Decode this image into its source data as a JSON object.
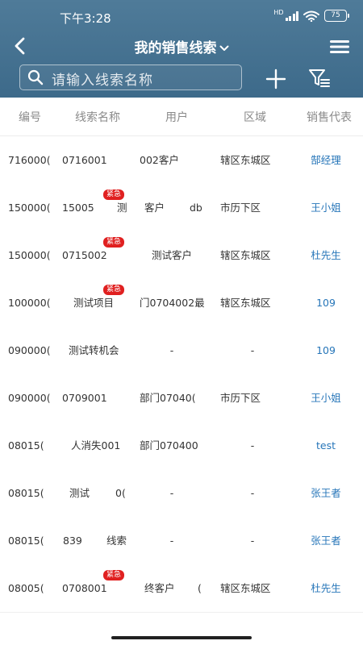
{
  "status_bar": {
    "time": "下午3:28",
    "signal_label": "HD",
    "battery": "75"
  },
  "nav": {
    "title": "我的销售线索"
  },
  "search": {
    "placeholder": "请输入线索名称"
  },
  "table": {
    "headers": [
      "编号",
      "线索名称",
      "用户",
      "区域",
      "销售代表"
    ],
    "rows": [
      {
        "code": "716000(",
        "name": "0716001",
        "urgent": false,
        "customer": "002客户",
        "region": "辖区东城区",
        "rep": "郜经理"
      },
      {
        "code": "150000(",
        "name": "15005",
        "name_extra": "测",
        "urgent": true,
        "customer": "客户",
        "customer_extra": "db",
        "region": "市历下区",
        "rep": "王小姐"
      },
      {
        "code": "150000(",
        "name": "0715002",
        "urgent": true,
        "customer": "测试客户",
        "region": "辖区东城区",
        "rep": "杜先生"
      },
      {
        "code": "100000(",
        "name": "测试项目",
        "urgent": true,
        "customer": "门0704002最",
        "region": "辖区东城区",
        "rep": "109"
      },
      {
        "code": "090000(",
        "name": "测试转机会",
        "urgent": false,
        "customer": "-",
        "region": "-",
        "rep": "109"
      },
      {
        "code": "090000(",
        "name": "0709001",
        "urgent": false,
        "customer": "部门07040(",
        "region": "市历下区",
        "rep": "王小姐"
      },
      {
        "code": "08015(",
        "name": "人消失001",
        "urgent": false,
        "customer": "部门070400",
        "region": "-",
        "rep": "test"
      },
      {
        "code": "08015(",
        "name": "测试",
        "name_extra": "0(",
        "urgent": false,
        "customer": "-",
        "region": "-",
        "rep": "张王者"
      },
      {
        "code": "08015(",
        "name": "839",
        "name_extra": "线索",
        "urgent": false,
        "customer": "-",
        "region": "-",
        "rep": "张王者"
      },
      {
        "code": "08005(",
        "name": "0708001",
        "urgent": true,
        "customer": "终客户",
        "customer_extra": "(",
        "region": "辖区东城区",
        "rep": "杜先生"
      }
    ],
    "urgent_label": "紧急"
  },
  "colors": {
    "header_bg": "#45708f",
    "link_blue": "#2776b9",
    "badge_red": "#e02020"
  }
}
